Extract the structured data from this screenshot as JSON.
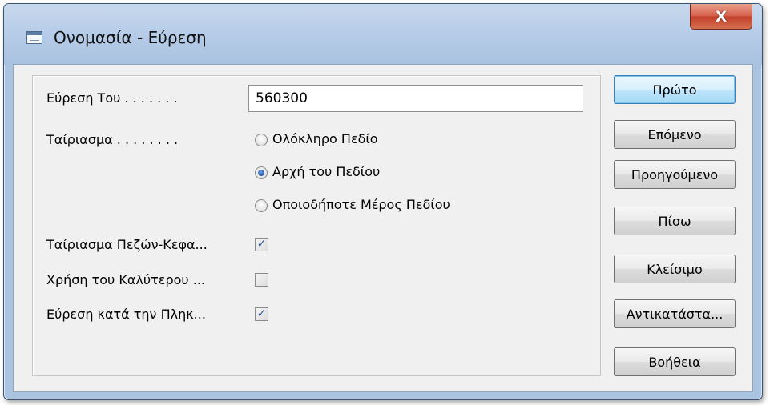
{
  "window": {
    "title": "Ονομασία - Εύρεση",
    "close_label": "X"
  },
  "form": {
    "find_label": "Εύρεση Του . . . . . . .",
    "find_value": "560300",
    "match_label": "Ταίριασμα . . . . . . . .",
    "match_options": [
      {
        "label": "Ολόκληρο Πεδίο",
        "checked": false
      },
      {
        "label": "Αρχή του Πεδίου",
        "checked": true
      },
      {
        "label": "Οποιοδήποτε Μέρος Πεδίου",
        "checked": false
      }
    ],
    "checkboxes": [
      {
        "label": "Ταίριασμα Πεζών-Κεφα...",
        "checked": true
      },
      {
        "label": "Χρήση του Καλύτερου ...",
        "checked": false
      },
      {
        "label": "Εύρεση κατά την Πληκ...",
        "checked": true
      }
    ]
  },
  "buttons": {
    "first": "Πρώτο",
    "next": "Επόμενο",
    "previous": "Προηγούμενο",
    "back": "Πίσω",
    "close": "Κλείσιμο",
    "replace": "Αντικατάστα...",
    "help": "Βοήθεια"
  },
  "colors": {
    "frame": "#aac4e0",
    "close_button": "#c3412b",
    "default_button": "#bee6fd"
  }
}
